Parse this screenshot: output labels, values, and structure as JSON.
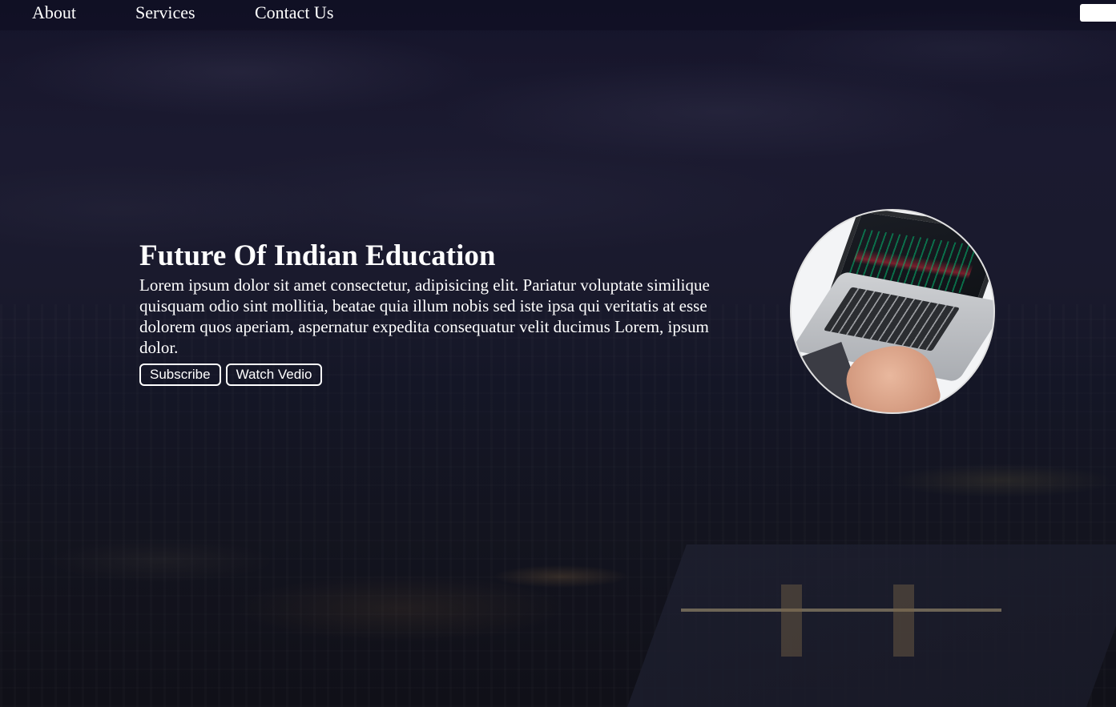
{
  "nav": {
    "items": [
      {
        "label": "About"
      },
      {
        "label": "Services"
      },
      {
        "label": "Contact Us"
      }
    ]
  },
  "hero": {
    "title": "Future Of Indian Education",
    "description": "Lorem ipsum dolor sit amet consectetur, adipisicing elit. Pariatur voluptate similique quisquam odio sint mollitia, beatae quia illum nobis sed iste ipsa qui veritatis at esse dolorem quos aperiam, aspernatur expedita consequatur velit ducimus Lorem, ipsum dolor.",
    "buttons": {
      "subscribe": "Subscribe",
      "watch": "Watch Vedio"
    }
  },
  "colors": {
    "text": "#ffffff",
    "background": "#17162b"
  }
}
